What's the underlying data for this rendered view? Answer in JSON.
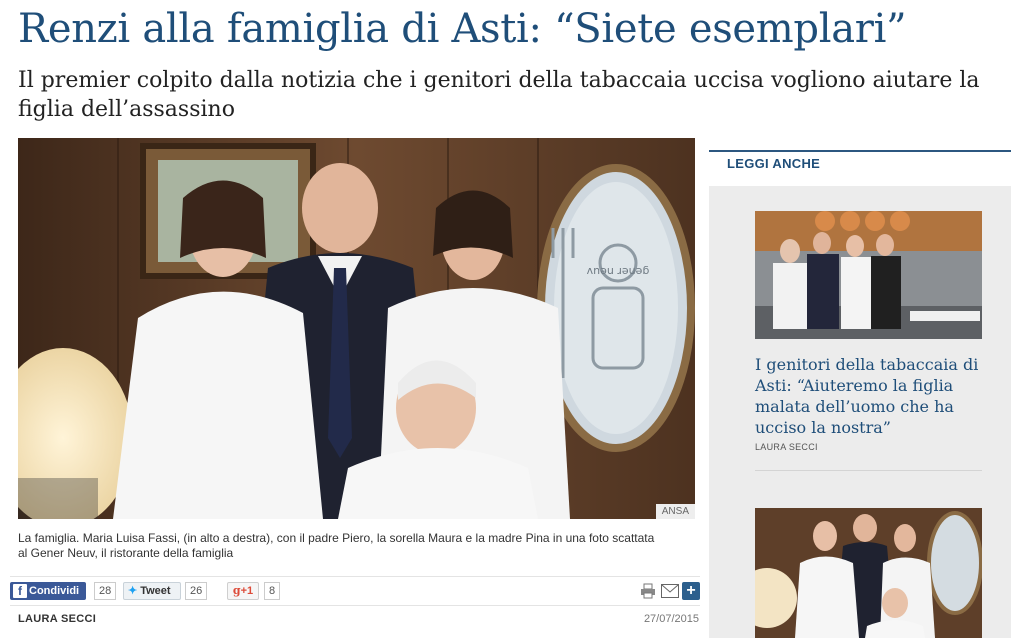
{
  "article": {
    "title": "Renzi alla famiglia di Asti: “Siete esemplari”",
    "subtitle": "Il premier colpito dalla notizia che i genitori della tabaccaia uccisa vogliono aiutare la figlia dell’assassino",
    "photo_credit": "ANSA",
    "caption": "La famiglia. Maria Luisa Fassi, (in alto a destra), con il padre Piero, la sorella Maura e la madre Pina in una foto scattata al Gener Neuv, il ristorante della famiglia",
    "sign_text": "gener neuv",
    "author": "LAURA SECCI",
    "date": "27/07/2015"
  },
  "share": {
    "facebook_label": "Condividi",
    "facebook_count": "28",
    "twitter_label": "Tweet",
    "twitter_count": "26",
    "gplus_label": "+1",
    "gplus_count": "8"
  },
  "sidebar": {
    "heading": "LEGGI ANCHE",
    "items": [
      {
        "title": "I genitori della tabaccaia di Asti: “Aiuteremo la figlia malata dell’uomo che ha ucciso la nostra”",
        "author": "LAURA SECCI"
      }
    ]
  },
  "colors": {
    "title_blue": "#1f4e79",
    "facebook": "#3b5998",
    "twitter_blue": "#1da1f2",
    "gplus_red": "#dd4b39",
    "sidebar_bg": "#ececec"
  }
}
